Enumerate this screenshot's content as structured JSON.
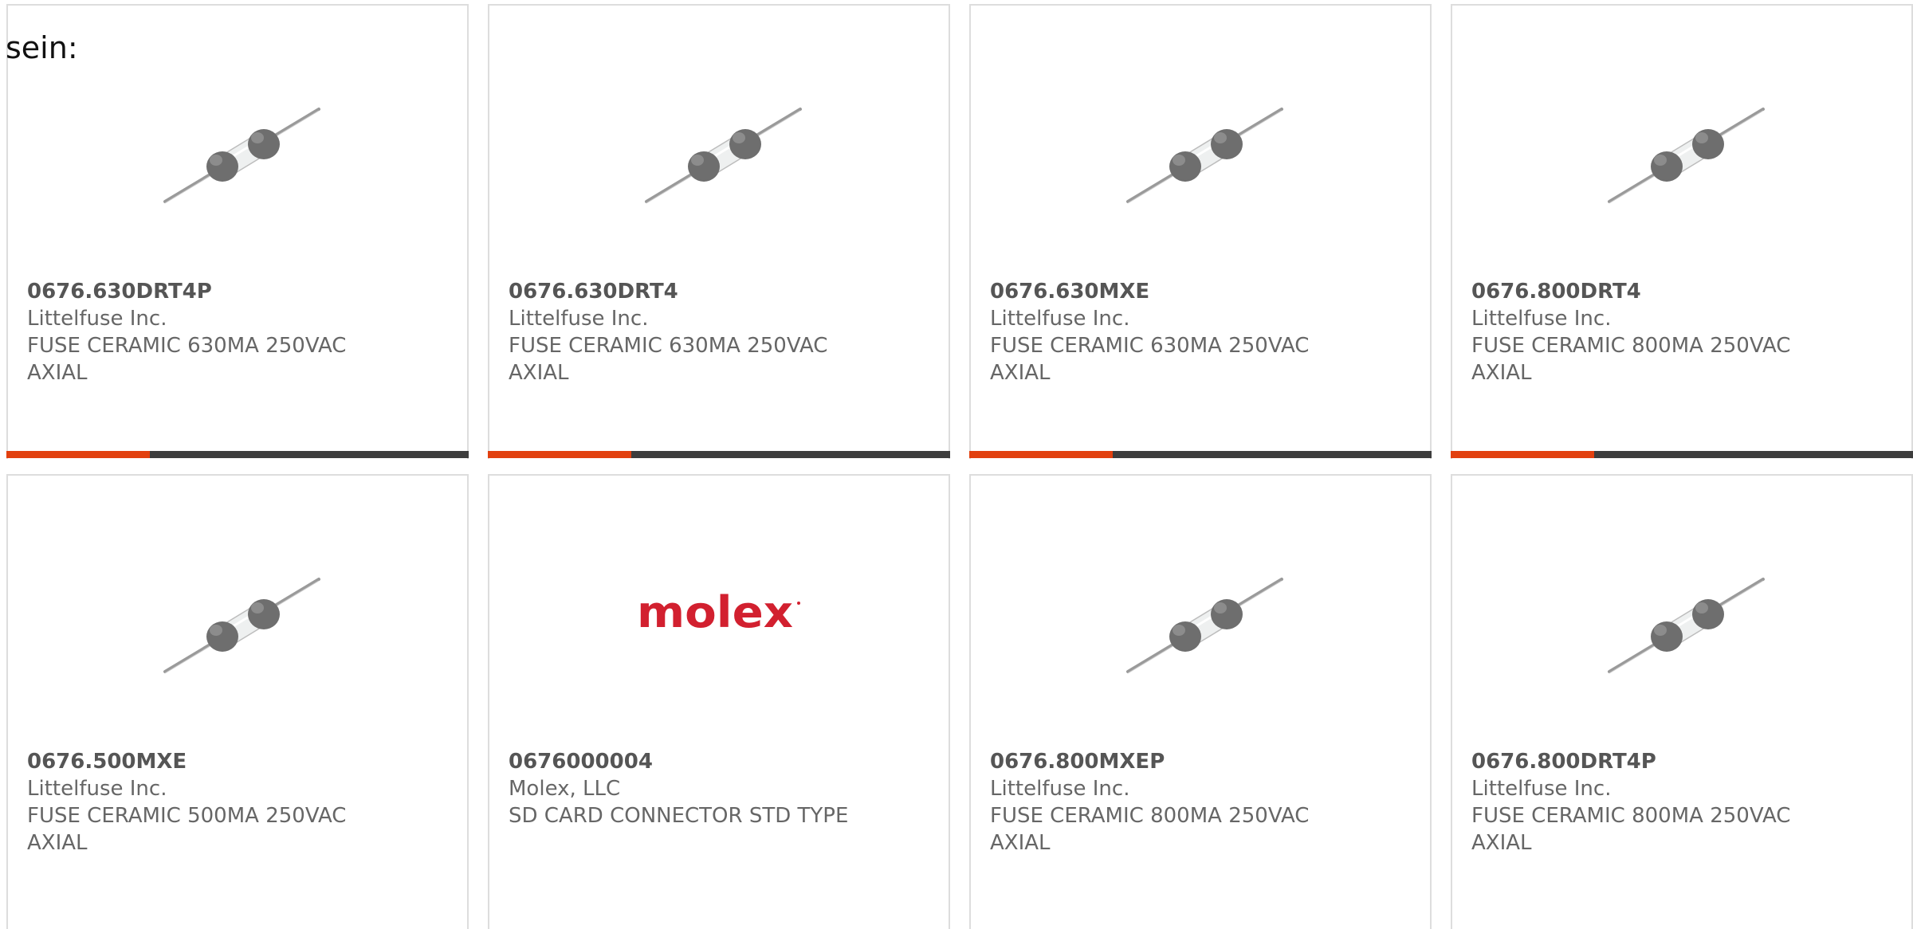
{
  "intro_text": "sein:",
  "colors": {
    "accent": "#e2400f",
    "bar_dark": "#3d3d3d",
    "border": "#dddddd",
    "text": "#666666",
    "molex_red": "#d2202f"
  },
  "products": [
    {
      "part_number": "0676.630DRT4P",
      "manufacturer": "Littelfuse Inc.",
      "description": "FUSE CERAMIC 630MA 250VAC AXIAL",
      "image": "fuse-icon",
      "progress": 0.31
    },
    {
      "part_number": "0676.630DRT4",
      "manufacturer": "Littelfuse Inc.",
      "description": "FUSE CERAMIC 630MA 250VAC AXIAL",
      "image": "fuse-icon",
      "progress": 0.31
    },
    {
      "part_number": "0676.630MXE",
      "manufacturer": "Littelfuse Inc.",
      "description": "FUSE CERAMIC 630MA 250VAC AXIAL",
      "image": "fuse-icon",
      "progress": 0.31
    },
    {
      "part_number": "0676.800DRT4",
      "manufacturer": "Littelfuse Inc.",
      "description": "FUSE CERAMIC 800MA 250VAC AXIAL",
      "image": "fuse-icon",
      "progress": 0.31
    },
    {
      "part_number": "0676.500MXE",
      "manufacturer": "Littelfuse Inc.",
      "description": "FUSE CERAMIC 500MA 250VAC AXIAL",
      "image": "fuse-icon"
    },
    {
      "part_number": "0676000004",
      "manufacturer": "Molex, LLC",
      "description": "SD CARD CONNECTOR STD TYPE",
      "image": "molex-logo",
      "logo_text": "molex"
    },
    {
      "part_number": "0676.800MXEP",
      "manufacturer": "Littelfuse Inc.",
      "description": "FUSE CERAMIC 800MA 250VAC AXIAL",
      "image": "fuse-icon"
    },
    {
      "part_number": "0676.800DRT4P",
      "manufacturer": "Littelfuse Inc.",
      "description": "FUSE CERAMIC 800MA 250VAC AXIAL",
      "image": "fuse-icon"
    }
  ]
}
